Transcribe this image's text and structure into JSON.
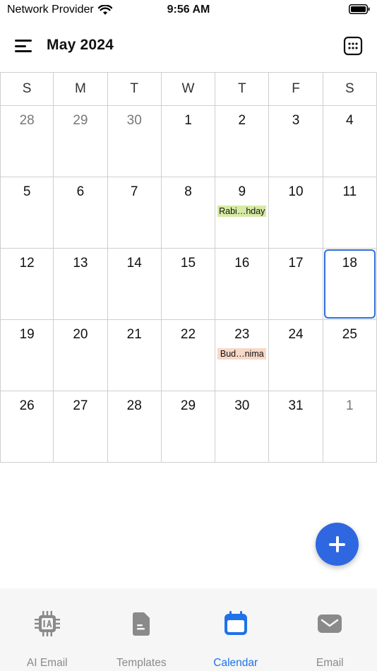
{
  "status_bar": {
    "carrier": "Network Provider",
    "time": "9:56 AM"
  },
  "header": {
    "title": "May 2024",
    "menu_icon": "hamburger-menu-icon",
    "view_icon": "calendar-grid-icon"
  },
  "weekdays": [
    "S",
    "M",
    "T",
    "W",
    "T",
    "F",
    "S"
  ],
  "weeks": [
    [
      {
        "day": "28",
        "muted": true
      },
      {
        "day": "29",
        "muted": true
      },
      {
        "day": "30",
        "muted": true
      },
      {
        "day": "1"
      },
      {
        "day": "2"
      },
      {
        "day": "3"
      },
      {
        "day": "4"
      }
    ],
    [
      {
        "day": "5"
      },
      {
        "day": "6"
      },
      {
        "day": "7"
      },
      {
        "day": "8"
      },
      {
        "day": "9",
        "event": "Rabi…hday",
        "event_color": "#d7eaa4"
      },
      {
        "day": "10"
      },
      {
        "day": "11"
      }
    ],
    [
      {
        "day": "12"
      },
      {
        "day": "13"
      },
      {
        "day": "14"
      },
      {
        "day": "15"
      },
      {
        "day": "16"
      },
      {
        "day": "17"
      },
      {
        "day": "18",
        "selected": true
      }
    ],
    [
      {
        "day": "19"
      },
      {
        "day": "20"
      },
      {
        "day": "21"
      },
      {
        "day": "22"
      },
      {
        "day": "23",
        "event": "Bud…nima",
        "event_color": "#f8d8c7"
      },
      {
        "day": "24"
      },
      {
        "day": "25"
      }
    ],
    [
      {
        "day": "26"
      },
      {
        "day": "27"
      },
      {
        "day": "28"
      },
      {
        "day": "29"
      },
      {
        "day": "30"
      },
      {
        "day": "31"
      },
      {
        "day": "1",
        "muted": true
      }
    ]
  ],
  "fab": {
    "icon": "plus-icon",
    "color": "#2f67e0"
  },
  "tabs": [
    {
      "label": "AI Email",
      "icon": "ai-chip-icon",
      "active": false
    },
    {
      "label": "Templates",
      "icon": "document-icon",
      "active": false
    },
    {
      "label": "Calendar",
      "icon": "calendar-icon",
      "active": true
    },
    {
      "label": "Email",
      "icon": "envelope-icon",
      "active": false
    }
  ],
  "colors": {
    "accent": "#1f72e8",
    "selected_border": "#2d6fdc",
    "inactive_tab": "#8a8a8a"
  }
}
